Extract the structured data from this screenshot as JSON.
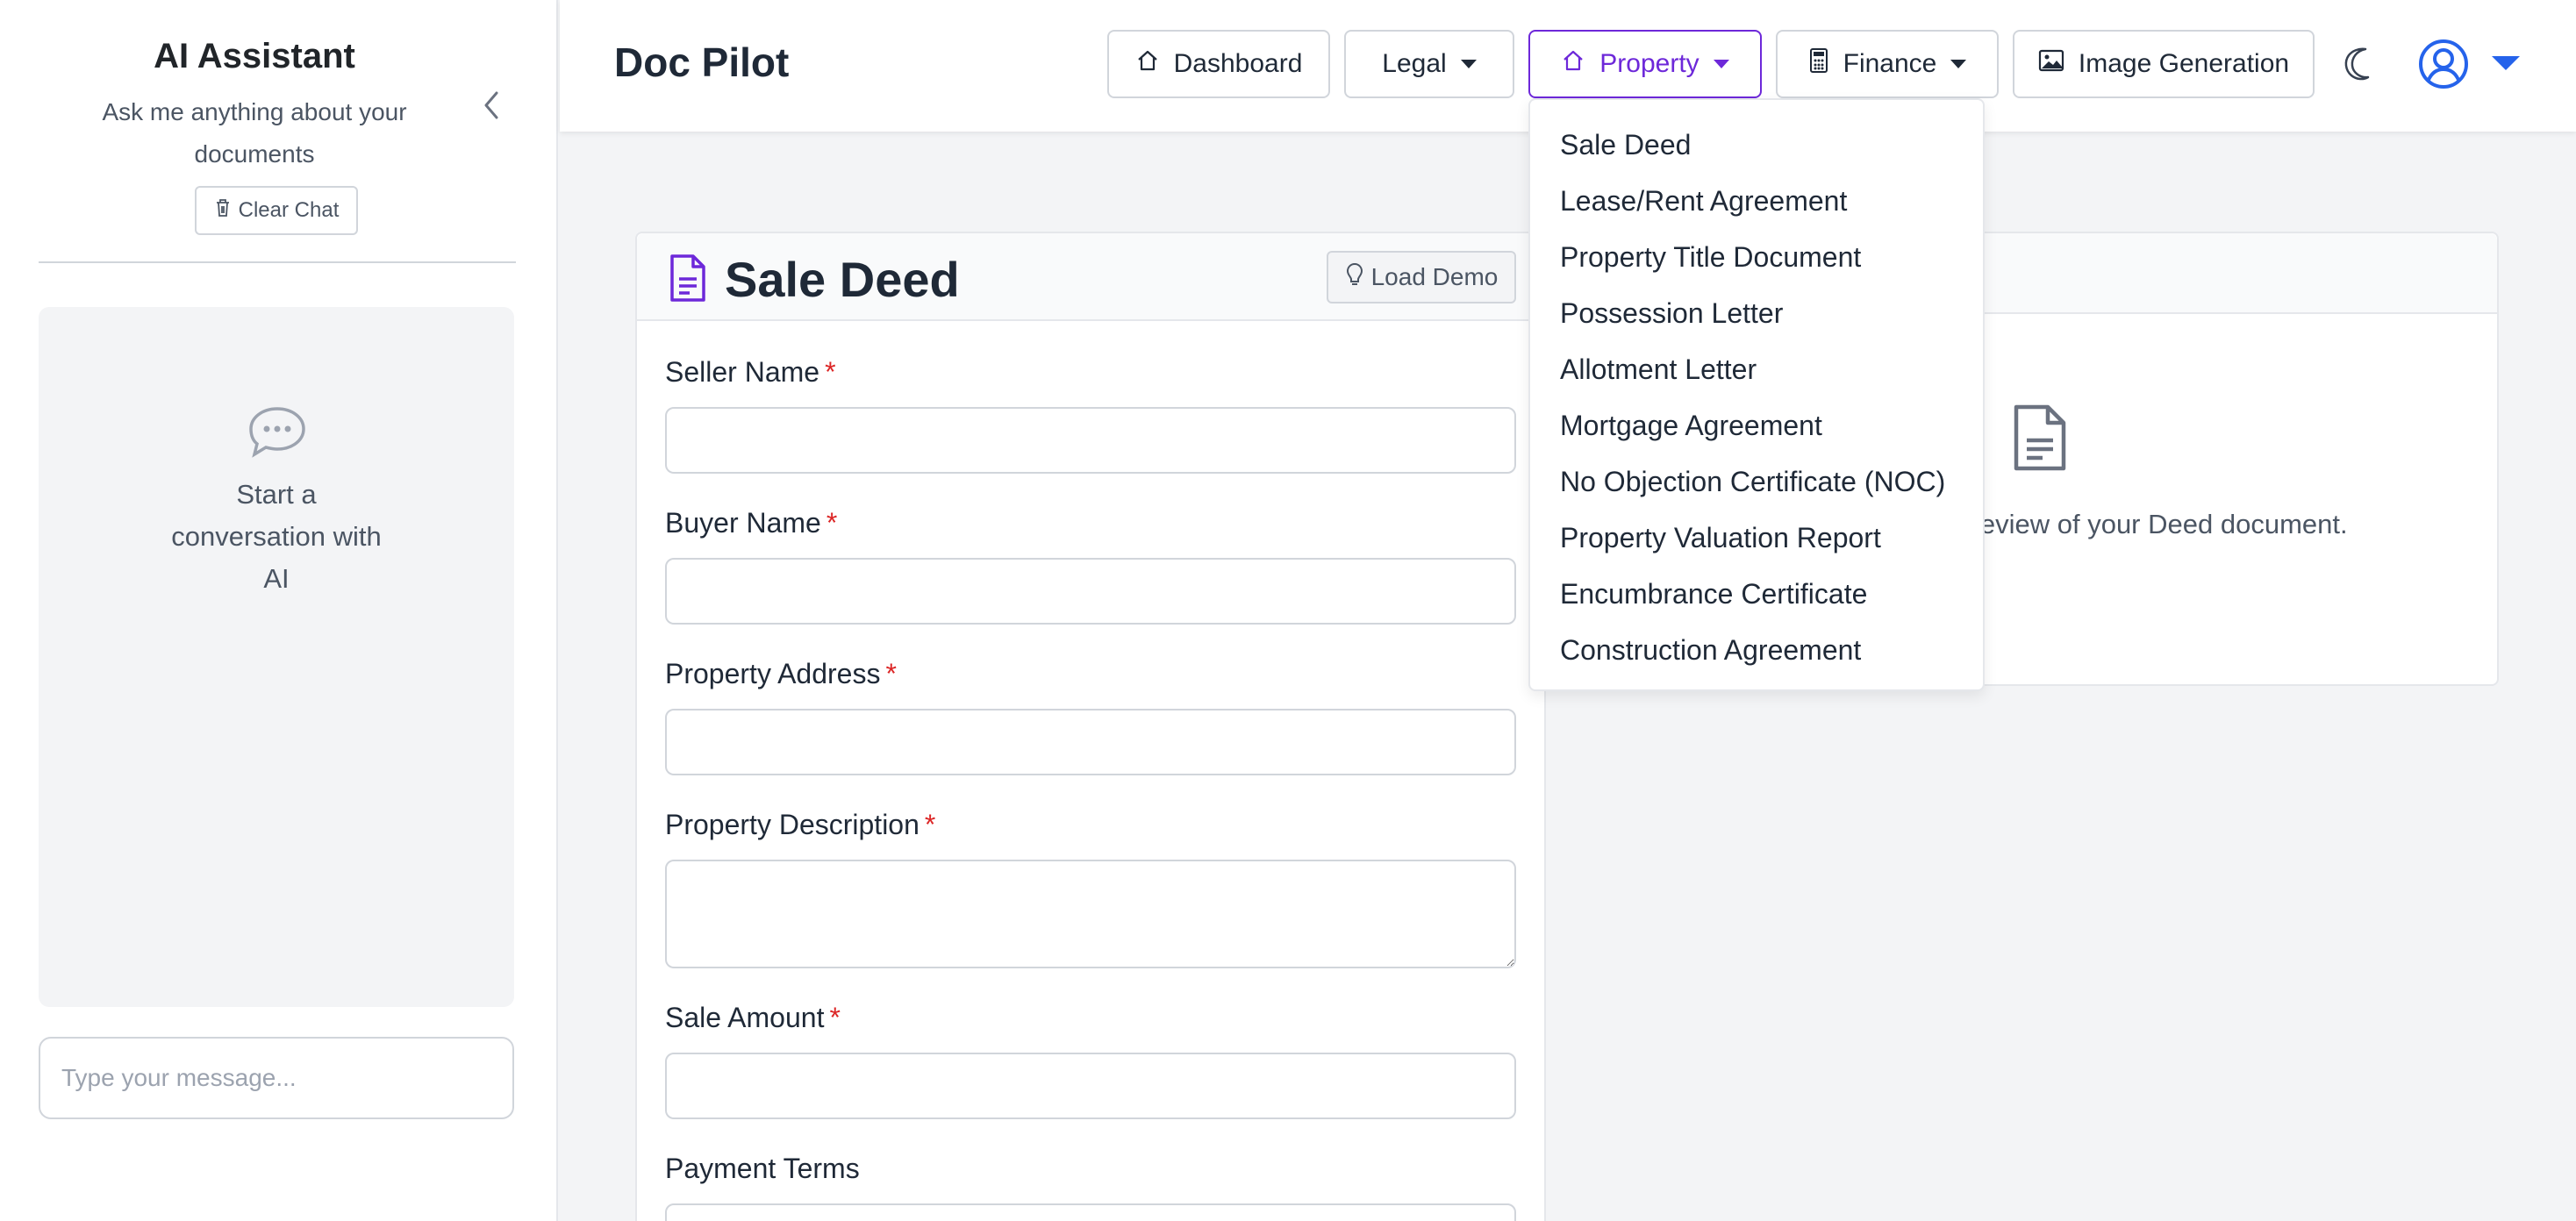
{
  "sidebar": {
    "title": "AI Assistant",
    "subtitle": "Ask me anything about your documents",
    "clear_chat_label": "Clear Chat",
    "empty_state": "Start a conversation with AI",
    "input_placeholder": "Type your message..."
  },
  "header": {
    "brand": "Doc Pilot",
    "nav": {
      "dashboard": "Dashboard",
      "legal": "Legal",
      "property": "Property",
      "finance": "Finance",
      "image_generation": "Image Generation"
    },
    "active_nav": "Property"
  },
  "property_menu": {
    "items": [
      "Sale Deed",
      "Lease/Rent Agreement",
      "Property Title Document",
      "Possession Letter",
      "Allotment Letter",
      "Mortgage Agreement",
      "No Objection Certificate (NOC)",
      "Property Valuation Report",
      "Encumbrance Certificate",
      "Construction Agreement"
    ]
  },
  "form": {
    "title": "Sale Deed",
    "load_demo_label": "Load Demo",
    "fields": {
      "seller_name": "Seller Name",
      "buyer_name": "Buyer Name",
      "property_address": "Property Address",
      "property_description": "Property Description",
      "sale_amount": "Sale Amount",
      "payment_terms": "Payment Terms"
    },
    "required_marker": "*"
  },
  "preview": {
    "empty_text": "Generate\" to see a live preview of your Deed document."
  },
  "colors": {
    "accent": "#6d28d9",
    "avatar": "#2563eb",
    "required": "#dc2626"
  }
}
